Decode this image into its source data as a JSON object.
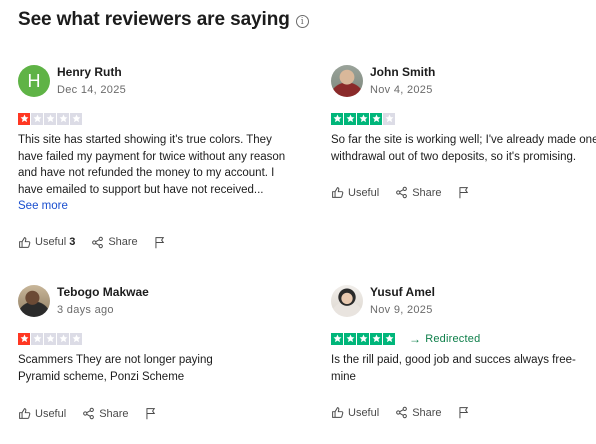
{
  "header": {
    "title": "See what reviewers are saying",
    "info_icon": "i"
  },
  "colors": {
    "star_bad": "#ff3722",
    "star_good": "#00b67a",
    "star_empty": "#dcdce6",
    "link": "#1a4fcf",
    "redirect": "#0e7f4a"
  },
  "reviews": [
    {
      "name": "Henry Ruth",
      "avatar_letter": "H",
      "date": "Dec 14, 2025",
      "rating": 1,
      "text": "This site has started showing it's true colors. They have failed my payment for twice without any reason and have not refunded the money to my account. I have emailed to support but have not received...",
      "see_more": "See more",
      "useful_label": "Useful",
      "useful_count": "3",
      "share_label": "Share"
    },
    {
      "name": "John Smith",
      "date": "Nov 4, 2025",
      "rating": 4,
      "text": "So far the site is working well; I've already made one withdrawal out of two deposits, so it's promising.",
      "useful_label": "Useful",
      "share_label": "Share"
    },
    {
      "name": "Tebogo Makwae",
      "date": "3 days ago",
      "rating": 1,
      "text_lines": [
        "Scammers They are not longer paying",
        "Pyramid scheme, Ponzi Scheme"
      ],
      "useful_label": "Useful",
      "share_label": "Share"
    },
    {
      "name": "Yusuf Amel",
      "date": "Nov 9, 2025",
      "rating": 5,
      "redirect_label": "Redirected",
      "text": "Is the rill paid, good job and succes always free-mine",
      "useful_label": "Useful",
      "share_label": "Share"
    }
  ]
}
